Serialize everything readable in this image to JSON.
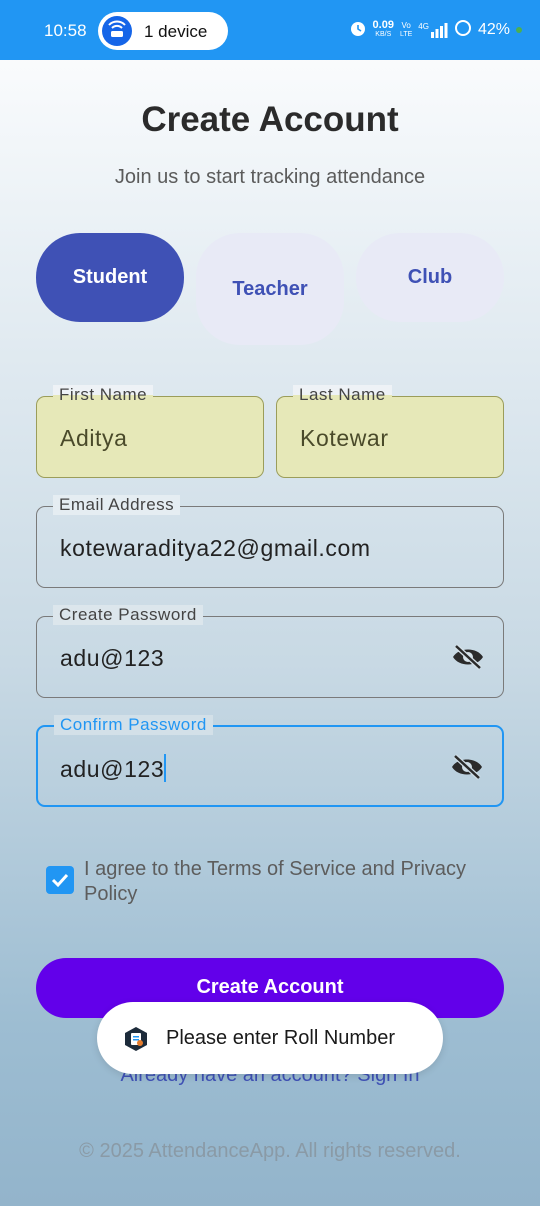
{
  "status_bar": {
    "time": "10:58",
    "hotspot_label": "1 device",
    "net_speed": "0.09",
    "net_unit": "KB/S",
    "volte_top": "Vo",
    "volte_bottom": "LTE",
    "network": "4G",
    "battery": "42%"
  },
  "header": {
    "title": "Create Account",
    "subtitle": "Join us to start tracking attendance"
  },
  "roles": {
    "student": "Student",
    "teacher": "Teacher",
    "club": "Club",
    "selected": "Student"
  },
  "form": {
    "first_name": {
      "label": "First Name",
      "value": "Aditya"
    },
    "last_name": {
      "label": "Last Name",
      "value": "Kotewar"
    },
    "email": {
      "label": "Email Address",
      "value": "kotewaraditya22@gmail.com"
    },
    "password": {
      "label": "Create Password",
      "value": "adu@123"
    },
    "confirm_password": {
      "label": "Confirm Password",
      "value": "adu@123"
    },
    "terms": {
      "label": "I agree to the Terms of Service and Privacy Policy",
      "checked": true
    }
  },
  "actions": {
    "create_account": "Create Account",
    "sign_in": "Already have an account? Sign In"
  },
  "toast": {
    "message": "Please enter Roll Number"
  },
  "footer": "© 2025 AttendanceApp. All rights reserved.",
  "colors": {
    "status_bar": "#2196f3",
    "primary": "#3f51b5",
    "button": "#6200ea",
    "focus": "#2196f3",
    "autofill": "#e6e8b8"
  }
}
